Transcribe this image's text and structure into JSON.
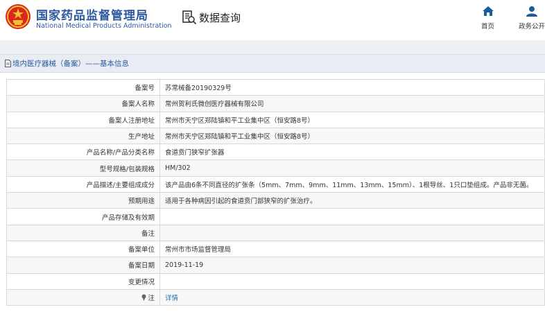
{
  "header": {
    "org_cn": "国家药品监督管理局",
    "org_en": "National Medical Products Administration",
    "query_label": "数据查询",
    "nav": [
      {
        "label": "首页",
        "icon": "home-icon"
      },
      {
        "label": "政务公开",
        "icon": "user-icon"
      }
    ]
  },
  "section": {
    "title": "境内医疗器械（备案）——基本信息"
  },
  "rows": [
    {
      "label": "备案号",
      "value": "苏常械备20190329号"
    },
    {
      "label": "备案人名称",
      "value": "常州贺利氏微创医疗器械有限公司"
    },
    {
      "label": "备案人注册地址",
      "value": "常州市天宁区郑陆镇和平工业集中区（恒安路8号）"
    },
    {
      "label": "生产地址",
      "value": "常州市天宁区郑陆镇和平工业集中区（恒安路8号）"
    },
    {
      "label": "产品名称/产品分类名称",
      "value": "食道贲门狭窄扩张器"
    },
    {
      "label": "型号规格/包装规格",
      "value": "HM/302"
    },
    {
      "label": "产品描述/主要组成成分",
      "value": "该产品由6条不同直径的扩张条（5mm、7mm、9mm、11mm、13mm、15mm）、1根导丝、1只口垫组成。产品非无菌。"
    },
    {
      "label": "预期用途",
      "value": "适用于各种病因引起的食道贲门部狭窄的扩张治疗。"
    },
    {
      "label": "产品存储及有效期",
      "value": ""
    },
    {
      "label": "备注",
      "value": ""
    },
    {
      "label": "备案单位",
      "value": "常州市市场监督管理局"
    },
    {
      "label": "备案日期",
      "value": "2019-11-19"
    },
    {
      "label": "变更情况",
      "value": ""
    }
  ],
  "note_row": {
    "label": "注",
    "link": "详情"
  },
  "colors": {
    "brand_blue": "#2c5aa0",
    "emblem_red": "#d9271c",
    "emblem_gold": "#f0c030",
    "link_blue": "#2c6cb5"
  }
}
